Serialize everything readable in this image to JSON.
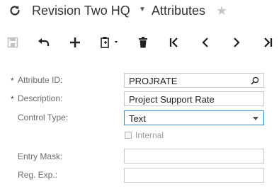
{
  "header": {
    "company": "Revision Two HQ",
    "title": "Attributes",
    "icons": {
      "refresh": "refresh-icon",
      "company_menu": "chevron-down-icon",
      "favorite": "star-icon"
    }
  },
  "toolbar": {
    "buttons": [
      "save-icon",
      "undo-icon",
      "add-icon",
      "copy-paste-icon",
      "delete-icon",
      "first-record-icon",
      "previous-record-icon",
      "next-record-icon",
      "last-record-icon"
    ]
  },
  "form": {
    "attribute_id": {
      "label": "Attribute ID:",
      "required_mark": "*",
      "value": "PROJRATE"
    },
    "description": {
      "label": "Description:",
      "required_mark": "*",
      "value": "Project Support Rate"
    },
    "control_type": {
      "label": "Control Type:",
      "value": "Text"
    },
    "internal": {
      "label": "Internal",
      "checked": false
    },
    "entry_mask": {
      "label": "Entry Mask:",
      "value": ""
    },
    "reg_exp": {
      "label": "Reg. Exp.:",
      "value": ""
    }
  },
  "colors": {
    "active_border": "#3c8dc5",
    "favorite_star": "#c8c8c8",
    "label": "#6b6b6b"
  }
}
